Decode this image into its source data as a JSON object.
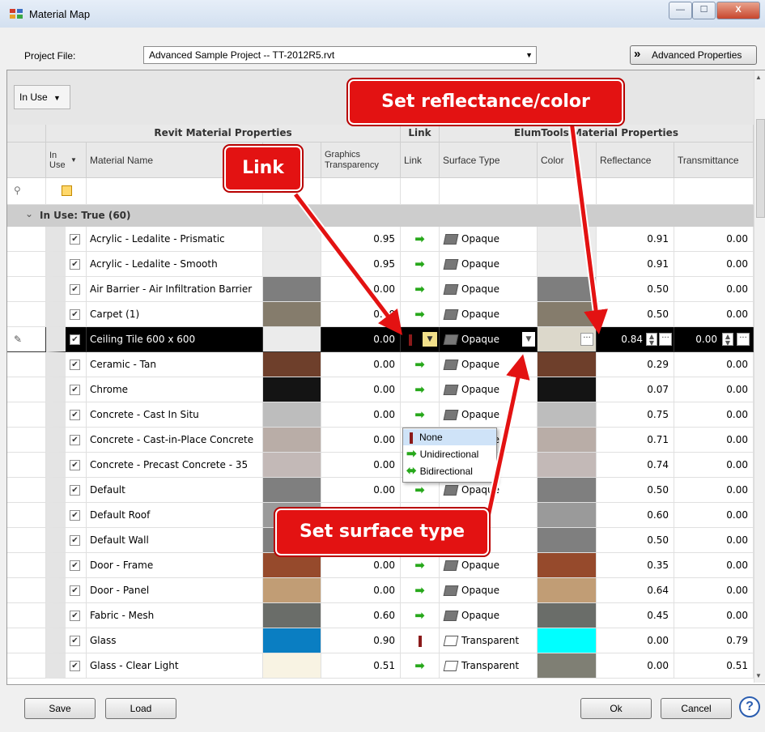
{
  "window": {
    "title": "Material Map",
    "min": "—",
    "max": "☐",
    "close": "X"
  },
  "project": {
    "label": "Project File:",
    "value": "Advanced Sample Project -- TT-2012R5.rvt",
    "adv_label": "Advanced Properties",
    "adv_icon": "»"
  },
  "filter": {
    "label": "In Use"
  },
  "headers": {
    "group_revit": "Revit Material Properties",
    "group_link": "Link",
    "group_elum": "ElumTools Material Properties",
    "col_inuse": "In Use",
    "col_name": "Material Name",
    "col_transp": "Graphics Transparency",
    "col_link": "Link",
    "col_surface": "Surface Type",
    "col_color": "Color",
    "col_refl": "Reflectance",
    "col_trans": "Transmittance"
  },
  "group": {
    "text": "In Use: True  (60)",
    "toggle": "⌄"
  },
  "rows": [
    {
      "name": "Acrylic - Ledalite - Prismatic",
      "swatch": "#e9e9e9",
      "transp": "0.95",
      "link": "arrow",
      "surface": "Opaque",
      "color": "#ececec",
      "refl": "0.91",
      "trans": "0.00"
    },
    {
      "name": "Acrylic - Ledalite - Smooth",
      "swatch": "#e9e9e9",
      "transp": "0.95",
      "link": "arrow",
      "surface": "Opaque",
      "color": "#ececec",
      "refl": "0.91",
      "trans": "0.00"
    },
    {
      "name": "Air Barrier - Air Infiltration Barrier",
      "swatch": "#7e7e7e",
      "transp": "0.00",
      "link": "arrow",
      "surface": "Opaque",
      "color": "#7e7e7e",
      "refl": "0.50",
      "trans": "0.00"
    },
    {
      "name": "Carpet (1)",
      "swatch": "#857c6c",
      "transp": "0.00",
      "link": "arrow",
      "surface": "Opaque",
      "color": "#857c6c",
      "refl": "0.50",
      "trans": "0.00"
    },
    {
      "name": "Ceiling Tile 600 x 600",
      "swatch": "#ebebeb",
      "transp": "0.00",
      "link": "none",
      "surface": "Opaque",
      "color": "#dcd8cb",
      "refl": "0.84",
      "trans": "0.00",
      "selected": true
    },
    {
      "name": "Ceramic - Tan",
      "swatch": "#6e3f2b",
      "transp": "0.00",
      "link": "arrow",
      "surface": "Opaque",
      "color": "#6e3f2b",
      "refl": "0.29",
      "trans": "0.00"
    },
    {
      "name": "Chrome",
      "swatch": "#141414",
      "transp": "0.00",
      "link": "arrow",
      "surface": "Opaque",
      "color": "#141414",
      "refl": "0.07",
      "trans": "0.00"
    },
    {
      "name": "Concrete - Cast In Situ",
      "swatch": "#bdbdbd",
      "transp": "0.00",
      "link": "arrow",
      "surface": "Opaque",
      "color": "#bdbdbd",
      "refl": "0.75",
      "trans": "0.00"
    },
    {
      "name": "Concrete - Cast-in-Place Concrete",
      "swatch": "#b9ada7",
      "transp": "0.00",
      "link": "arrow",
      "surface": "Opaque",
      "color": "#b9ada7",
      "refl": "0.71",
      "trans": "0.00"
    },
    {
      "name": "Concrete - Precast Concrete - 35",
      "swatch": "#c3b9b7",
      "transp": "0.00",
      "link": "arrow",
      "surface": "Opaque",
      "color": "#c3b9b7",
      "refl": "0.74",
      "trans": "0.00"
    },
    {
      "name": "Default",
      "swatch": "#7f7f7f",
      "transp": "0.00",
      "link": "arrow",
      "surface": "Opaque",
      "color": "#7f7f7f",
      "refl": "0.50",
      "trans": "0.00"
    },
    {
      "name": "Default Roof",
      "swatch": "#9a9a9a",
      "transp": "",
      "link": "",
      "surface": "",
      "color": "#9a9a9a",
      "refl": "0.60",
      "trans": "0.00"
    },
    {
      "name": "Default Wall",
      "swatch": "#7f7f7f",
      "transp": "",
      "link": "",
      "surface": "",
      "color": "#7f7f7f",
      "refl": "0.50",
      "trans": "0.00"
    },
    {
      "name": "Door - Frame",
      "swatch": "#964a2c",
      "transp": "0.00",
      "link": "arrow",
      "surface": "Opaque",
      "color": "#964a2c",
      "refl": "0.35",
      "trans": "0.00"
    },
    {
      "name": "Door - Panel",
      "swatch": "#c19d75",
      "transp": "0.00",
      "link": "arrow",
      "surface": "Opaque",
      "color": "#c19d75",
      "refl": "0.64",
      "trans": "0.00"
    },
    {
      "name": "Fabric - Mesh",
      "swatch": "#6a6d69",
      "transp": "0.60",
      "link": "arrow",
      "surface": "Opaque",
      "color": "#6a6d69",
      "refl": "0.45",
      "trans": "0.00"
    },
    {
      "name": "Glass",
      "swatch": "#0a7ec2",
      "transp": "0.90",
      "link": "none",
      "surface": "Transparent",
      "color": "#00ffff",
      "refl": "0.00",
      "trans": "0.79"
    },
    {
      "name": "Glass - Clear Light",
      "swatch": "#f8f3e3",
      "transp": "0.51",
      "link": "arrow",
      "surface": "Transparent",
      "color": "#7f7f74",
      "refl": "0.00",
      "trans": "0.51"
    }
  ],
  "dropdown": {
    "none": "None",
    "uni": "Unidirectional",
    "bi": "Bidirectional"
  },
  "callouts": {
    "reflectance": "Set reflectance/color",
    "link": "Link",
    "surface": "Set surface type"
  },
  "buttons": {
    "save": "Save",
    "load": "Load",
    "ok": "Ok",
    "cancel": "Cancel",
    "help": "?"
  },
  "colors": {
    "accent_red": "#e31212",
    "link_green": "#27a81b",
    "none_red": "#8b1a1a"
  }
}
